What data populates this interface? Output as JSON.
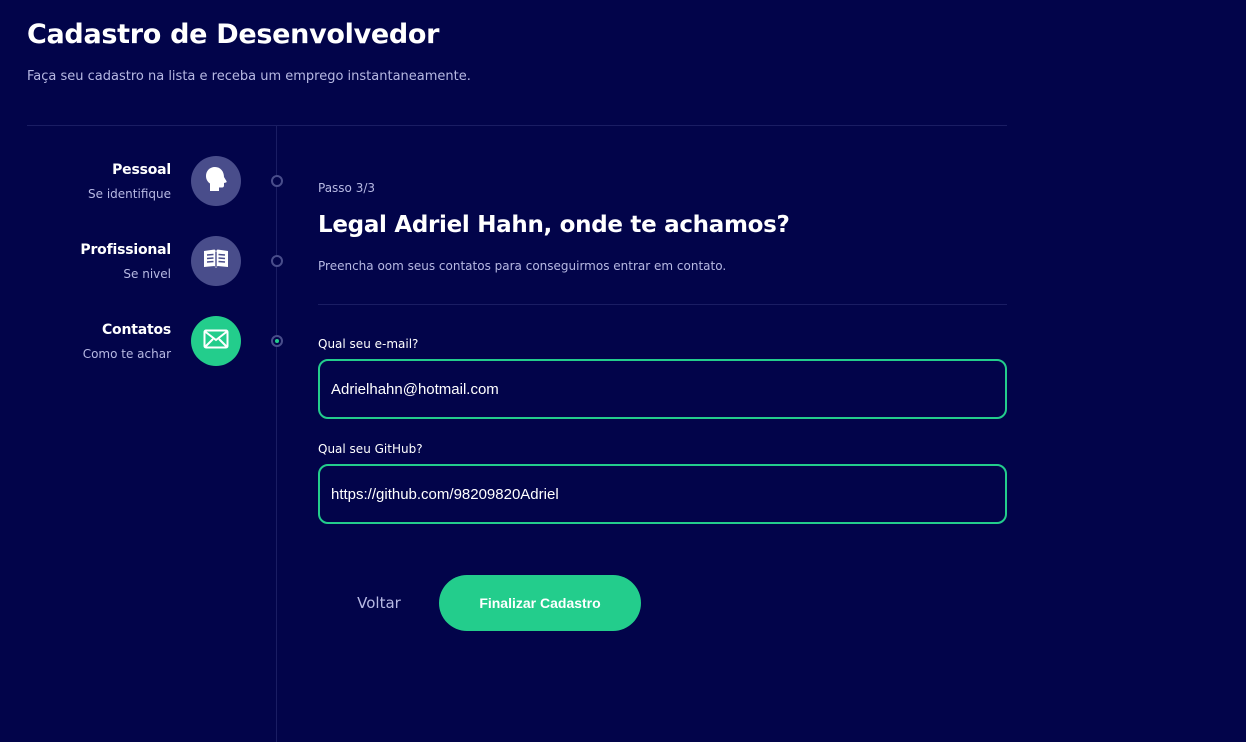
{
  "header": {
    "title": "Cadastro de Desenvolvedor",
    "subtitle": "Faça seu cadastro na lista e receba um emprego instantaneamente."
  },
  "steps": [
    {
      "label": "Pessoal",
      "description": "Se identifique",
      "icon": "person-head-icon",
      "active": false
    },
    {
      "label": "Profissional",
      "description": "Se nivel",
      "icon": "open-book-icon",
      "active": false
    },
    {
      "label": "Contatos",
      "description": "Como te achar",
      "icon": "envelope-icon",
      "active": true
    }
  ],
  "form": {
    "step_counter": "Passo 3/3",
    "title": "Legal Adriel Hahn, onde te achamos?",
    "description": "Preencha oom seus contatos para conseguirmos entrar em contato.",
    "email": {
      "label": "Qual seu e-mail?",
      "value": "Adrielhahn@hotmail.com"
    },
    "github": {
      "label": "Qual seu GitHub?",
      "value": "https://github.com/98209820Adriel"
    },
    "back_label": "Voltar",
    "submit_label": "Finalizar Cadastro"
  },
  "colors": {
    "background": "#02044a",
    "accent": "#23cd8c",
    "inactive_step": "#494d8b",
    "muted_text": "#b7b9e3"
  }
}
